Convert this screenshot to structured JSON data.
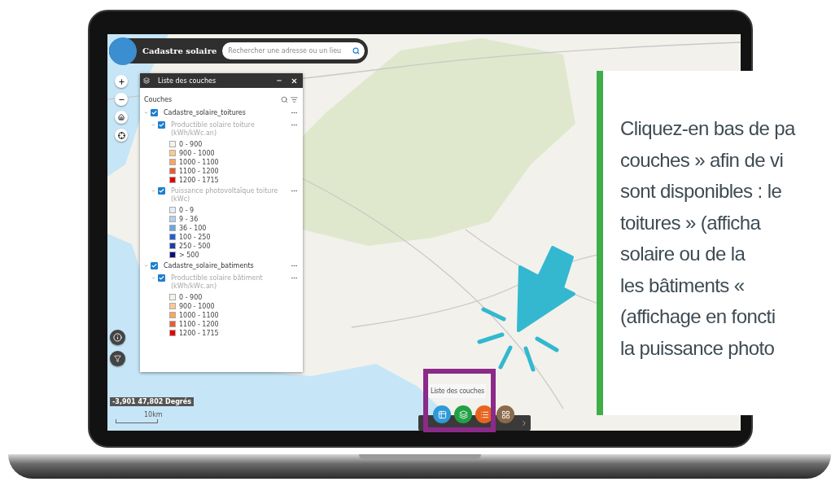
{
  "app": {
    "title": "Cadastre solaire",
    "search": {
      "placeholder": "Rechercher une adresse ou un lieu"
    }
  },
  "layer_panel": {
    "title": "Liste des couches",
    "section_label": "Couches",
    "layers": [
      {
        "name": "Cadastre_solaire_toitures",
        "checked": true,
        "expanded": true,
        "dimmed": false,
        "children": [
          {
            "name": "Productible solaire toiture (kWh/kWc.an)",
            "checked": true,
            "expanded": true,
            "dimmed": true,
            "legend": [
              {
                "label": "0 - 900",
                "color": "#f6f3ec"
              },
              {
                "label": "900 - 1000",
                "color": "#fdc98f"
              },
              {
                "label": "1000 - 1100",
                "color": "#fca65a"
              },
              {
                "label": "1100 - 1200",
                "color": "#ef5a2b"
              },
              {
                "label": "1200 - 1715",
                "color": "#e60000"
              }
            ]
          },
          {
            "name": "Puissance photovoltaïque toiture (kWc)",
            "checked": true,
            "expanded": true,
            "dimmed": true,
            "legend": [
              {
                "label": "0 - 9",
                "color": "#e3eff5"
              },
              {
                "label": "9 - 36",
                "color": "#b3d0ec"
              },
              {
                "label": "36 - 100",
                "color": "#6aa6e0"
              },
              {
                "label": "100 - 250",
                "color": "#1f5fd6"
              },
              {
                "label": "250 - 500",
                "color": "#1b3cac"
              },
              {
                "label": "> 500",
                "color": "#0b0c80"
              }
            ]
          }
        ]
      },
      {
        "name": "Cadastre_solaire_batiments",
        "checked": true,
        "expanded": true,
        "dimmed": false,
        "children": [
          {
            "name": "Productible solaire bâtiment (kWh/kWc.an)",
            "checked": true,
            "expanded": true,
            "dimmed": true,
            "legend": [
              {
                "label": "0 - 900",
                "color": "#f6f3ec"
              },
              {
                "label": "900 - 1000",
                "color": "#fdc98f"
              },
              {
                "label": "1000 - 1100",
                "color": "#fca65a"
              },
              {
                "label": "1100 - 1200",
                "color": "#ef5a2b"
              },
              {
                "label": "1200 - 1715",
                "color": "#e60000"
              }
            ]
          }
        ]
      }
    ]
  },
  "coordinates": "-3,901 47,802 Degrés",
  "scale": "10km",
  "dock": {
    "tooltip": "Liste des couches",
    "buttons": [
      {
        "kind": "table",
        "color": "#2e9ad8"
      },
      {
        "kind": "layers",
        "color": "#22a045"
      },
      {
        "kind": "list",
        "color": "#e8641e"
      },
      {
        "kind": "grid",
        "color": "#8a6a4a"
      }
    ]
  },
  "callout": {
    "lines": [
      "Cliquez-en bas de pa",
      "couches » afin de vi",
      "sont disponibles : le",
      "toitures » (afficha",
      "solaire ou de la",
      "les bâtiments «",
      "(affichage en foncti",
      "la puissance photo"
    ]
  }
}
